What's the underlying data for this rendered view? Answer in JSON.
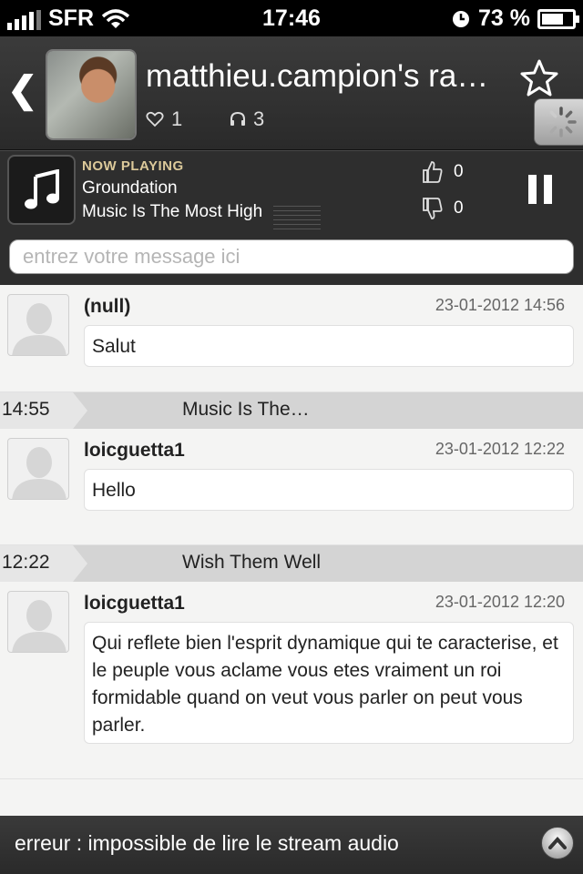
{
  "status_bar": {
    "carrier": "SFR",
    "time": "17:46",
    "battery_percent": "73 %",
    "battery_level": 0.73,
    "icons": [
      "signal-bars-icon",
      "wifi-icon",
      "clock-icon",
      "battery-charging-icon"
    ]
  },
  "header": {
    "back_icon": "chevron-left-icon",
    "title": "matthieu.campion's ra…",
    "likes": "1",
    "listeners": "3",
    "favorite_icon": "star-outline-icon",
    "loading_icon": "spinner-icon"
  },
  "now_playing": {
    "label": "NOW PLAYING",
    "artist": "Groundation",
    "song": "Music Is The Most High",
    "thumbs_up": "0",
    "thumbs_down": "0",
    "control_icon": "pause-icon"
  },
  "message_input": {
    "placeholder": "entrez votre message ici",
    "value": ""
  },
  "feed": {
    "messages": [
      {
        "user": "(null)",
        "date": "23-01-2012 14:56",
        "text": "Salut"
      },
      {
        "user": "loicguetta1",
        "date": "23-01-2012 12:22",
        "text": "Hello"
      },
      {
        "user": "loicguetta1",
        "date": "23-01-2012 12:20",
        "text": "Qui reflete bien l'esprit dynamique qui te caracterise, et le peuple vous aclame vous etes vraiment un roi formidable quand on veut vous parler on peut vous parler."
      }
    ],
    "tracks": [
      {
        "time": "14:55",
        "name": "Music Is The…"
      },
      {
        "time": "12:22",
        "name": "Wish Them Well"
      }
    ]
  },
  "bottom_bar": {
    "error": "erreur : impossible de lire le stream audio",
    "expand_icon": "chevron-up-icon"
  },
  "colors": {
    "header_bg": "#333333",
    "now_playing_label": "#dcc99a",
    "feed_bg": "#f4f4f3",
    "track_divider": "#d4d4d4"
  }
}
